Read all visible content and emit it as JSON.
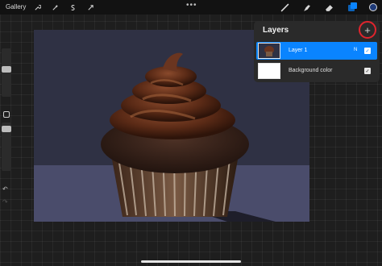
{
  "toolbar": {
    "gallery_label": "Gallery",
    "menu_dots": "•••",
    "left_tools": [
      "wrench-icon",
      "magic-wand-icon",
      "selection-icon",
      "transform-icon"
    ],
    "right_tools": [
      "brush-icon",
      "smudge-icon",
      "eraser-icon",
      "layers-icon",
      "color-icon"
    ],
    "accent_color": "#0a84ff",
    "current_color": "#1e3a78"
  },
  "layers_panel": {
    "title": "Layers",
    "add_label": "+",
    "add_highlight_color": "#e0242d",
    "layers": [
      {
        "name": "Layer 1",
        "blend": "N",
        "visible_mark": "✓",
        "selected": true
      },
      {
        "name": "Background color",
        "blend": "",
        "visible_mark": "✓",
        "selected": false
      }
    ]
  },
  "sidebar": {
    "undo_icon": "↶",
    "redo_icon": "↷"
  },
  "canvas": {
    "background_color": "#2f3144",
    "floor_color": "#4a4c6b",
    "subject": "chocolate-cupcake"
  }
}
